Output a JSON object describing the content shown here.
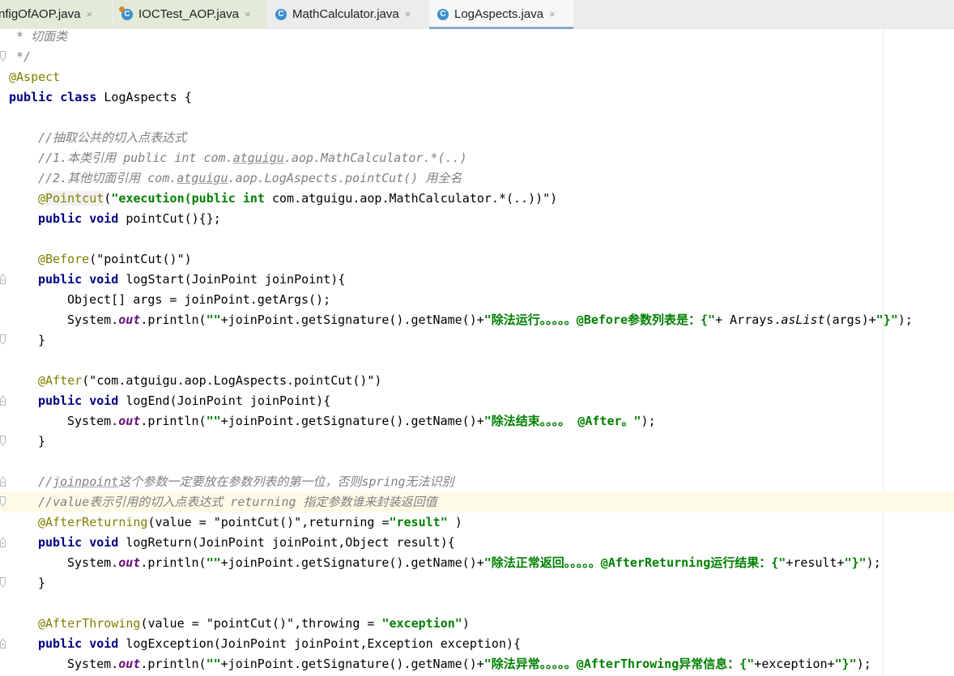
{
  "tabs": [
    {
      "label": "nfigOfAOP.java",
      "close": "×"
    },
    {
      "label": "IOCTest_AOP.java",
      "close": "×",
      "icon": "test-class-icon"
    },
    {
      "label": "MathCalculator.java",
      "close": "×",
      "icon": "class-icon"
    },
    {
      "label": "LogAspects.java",
      "close": "×",
      "icon": "class-icon"
    }
  ],
  "class_icon_letter": "C",
  "colors": {
    "keyword": "#000080",
    "annotation": "#808000",
    "string": "#008000",
    "comment": "#808080",
    "field": "#660e7a"
  },
  "code": {
    "l1": " * 切面类",
    "l2": " */",
    "l3": "@Aspect",
    "l4_kw": "public class",
    "l4_rest": " LogAspects {",
    "l6": "//抽取公共的切入点表达式",
    "l7a": "//1.本类引用 public int com.",
    "l7b": "atguigu",
    "l7c": ".aop.MathCalculator.*(..)",
    "l8a": "//2.其他切面引用 com.",
    "l8b": "atguigu",
    "l8c": ".aop.LogAspects.pointCut() 用全名",
    "l9a": "@",
    "l9b": "Pointcut",
    "l9c": "(",
    "l9d": "\"execution(public int ",
    "l9e": "com.atguigu.aop.MathCalculator.*(..))\"",
    "l9f": ")",
    "l10_kw": "public void",
    "l10_rest": " pointCut(){};",
    "l12a": "@Before",
    "l12b": "(\"pointCut()\")",
    "l13_kw": "public void",
    "l13_rest": " logStart(JoinPoint joinPoint){",
    "l14": "Object[] args = joinPoint.getArgs();",
    "l15a": "System.",
    "l15b": "out",
    "l15c": ".println(",
    "l15d": "\"\"",
    "l15e": "+joinPoint.getSignature().getName()+",
    "l15f": "\"除法运行。。。。。@Before参数列表是：{\"",
    "l15g": "+ Arrays.",
    "l15h": "asList",
    "l15i": "(args)+",
    "l15j": "\"}\"",
    "l15k": ");",
    "l16": "}",
    "l18a": "@After",
    "l18b": "(\"com.atguigu.aop.LogAspects.pointCut()\")",
    "l19_kw": "public void",
    "l19_rest": " logEnd(JoinPoint joinPoint){",
    "l20a": "System.",
    "l20b": "out",
    "l20c": ".println(",
    "l20d": "\"\"",
    "l20e": "+joinPoint.getSignature().getName()+",
    "l20f": "\"除法结束。。。。 @After。\"",
    "l20g": ");",
    "l21": "}",
    "l23a": "//",
    "l23b": "joinpoint",
    "l23c": "这个参数一定要放在参数列表的第一位，否则spring无法识别",
    "l24": "//value表示引用的切入点表达式 returning 指定参数谁来封装返回值",
    "l25a": "@AfterReturning",
    "l25b": "(value = ",
    "l25c": "\"pointCut()\"",
    "l25d": ",returning =",
    "l25e": "\"result\"",
    "l25f": " )",
    "l26_kw": "public void",
    "l26_rest": " logReturn(JoinPoint joinPoint,Object result){",
    "l27a": "System.",
    "l27b": "out",
    "l27c": ".println(",
    "l27d": "\"\"",
    "l27e": "+joinPoint.getSignature().getName()+",
    "l27f": "\"除法正常返回。。。。。@AfterReturning运行结果：{\"",
    "l27g": "+result+",
    "l27h": "\"}\"",
    "l27i": ");",
    "l28": "}",
    "l30a": "@AfterThrowing",
    "l30b": "(value = ",
    "l30c": "\"pointCut()\"",
    "l30d": ",throwing = ",
    "l30e": "\"exception\"",
    "l30f": ")",
    "l31_kw": "public void",
    "l31_rest": " logException(JoinPoint joinPoint,Exception exception){",
    "l32a": "System.",
    "l32b": "out",
    "l32c": ".println(",
    "l32d": "\"\"",
    "l32e": "+joinPoint.getSignature().getName()+",
    "l32f": "\"除法异常。。。。。@AfterThrowing异常信息：{\"",
    "l32g": "+exception+",
    "l32h": "\"}\"",
    "l32i": ");"
  }
}
